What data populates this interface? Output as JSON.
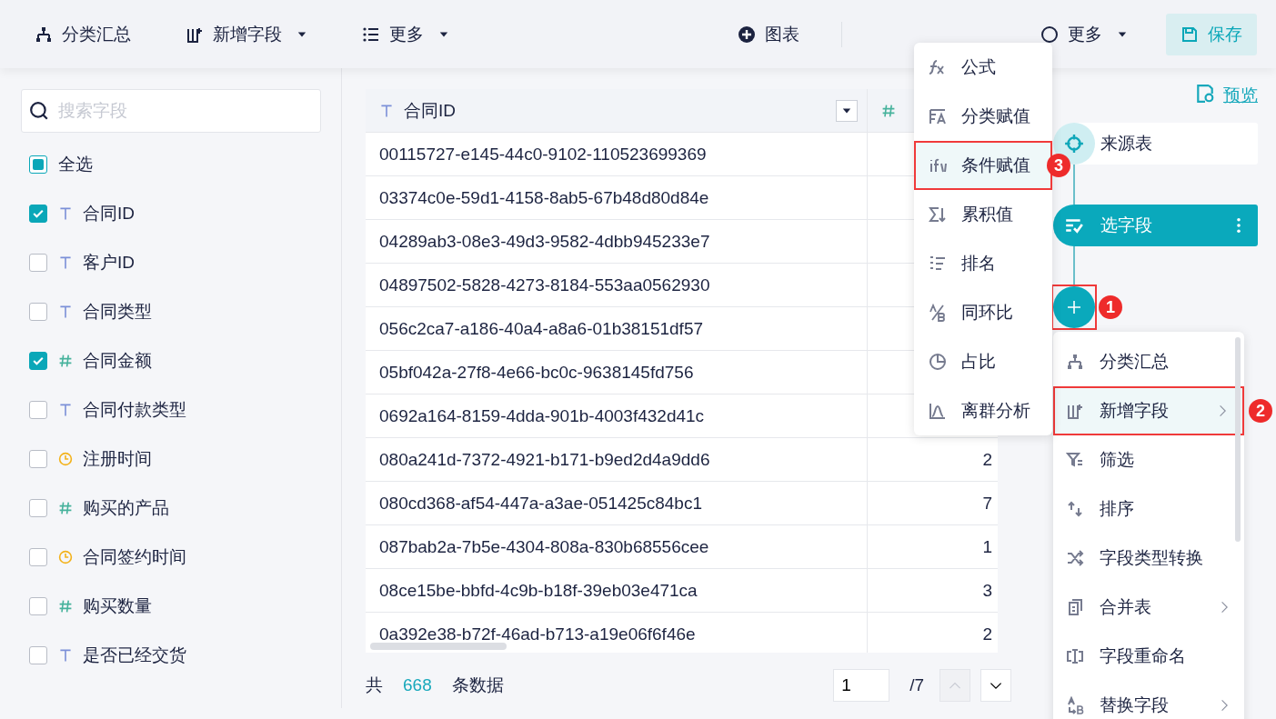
{
  "toolbar": {
    "left": [
      {
        "kind": "summary",
        "label": "分类汇总",
        "dropdown": false
      },
      {
        "kind": "add_field",
        "label": "新增字段",
        "dropdown": true
      },
      {
        "kind": "list",
        "label": "更多",
        "dropdown": true
      }
    ],
    "right": [
      {
        "kind": "chart",
        "label": "图表",
        "dropdown": false
      },
      {
        "kind": "more",
        "label": "更多",
        "dropdown": true
      }
    ],
    "save": "保存"
  },
  "field_panel": {
    "search": {
      "placeholder": "搜索字段"
    },
    "select_all": {
      "label": "全选",
      "checked": false,
      "indeterminate": true
    },
    "fields": [
      {
        "kind": "text",
        "name": "合同ID",
        "checked": true
      },
      {
        "kind": "text",
        "name": "客户ID",
        "checked": false
      },
      {
        "kind": "text",
        "name": "合同类型",
        "checked": false
      },
      {
        "kind": "number",
        "name": "合同金额",
        "checked": true
      },
      {
        "kind": "text",
        "name": "合同付款类型",
        "checked": false
      },
      {
        "kind": "date",
        "name": "注册时间",
        "checked": false
      },
      {
        "kind": "number",
        "name": "购买的产品",
        "checked": false
      },
      {
        "kind": "date",
        "name": "合同签约时间",
        "checked": false
      },
      {
        "kind": "number",
        "name": "购买数量",
        "checked": false
      },
      {
        "kind": "text",
        "name": "是否已经交货",
        "checked": false
      }
    ]
  },
  "table": {
    "columns": [
      {
        "kind": "text",
        "name": "合同ID"
      },
      {
        "kind": "number"
      }
    ],
    "rows": [
      [
        "00115727-e145-44c0-9102-110523699369"
      ],
      [
        "03374c0e-59d1-4158-8ab5-67b48d80d84e"
      ],
      [
        "04289ab3-08e3-49d3-9582-4dbb945233e7"
      ],
      [
        "04897502-5828-4273-8184-553aa0562930"
      ],
      [
        "056c2ca7-a186-40a4-a8a6-01b38151df57"
      ],
      [
        "05bf042a-27f8-4e66-bc0c-9638145fd756"
      ],
      [
        "0692a164-8159-4dda-901b-4003f432d41c"
      ],
      [
        "080a241d-7372-4921-b171-b9ed2d4a9dd6",
        "2"
      ],
      [
        "080cd368-af54-447a-a3ae-051425c84bc1",
        "7"
      ],
      [
        "087bab2a-7b5e-4304-808a-830b68556cee",
        "1"
      ],
      [
        "08ce15be-bbfd-4c9b-b18f-39eb03e471ca",
        "3"
      ],
      [
        "0a392e38-b72f-46ad-b713-a19e06f6f46e",
        "2"
      ]
    ]
  },
  "footer": {
    "prefix": "共",
    "count": "668",
    "suffix": "条数据",
    "page": "1",
    "pages": "/7",
    "prev_button": {
      "disabled": true
    },
    "next_button": {
      "disabled": false
    }
  },
  "preview": "预览",
  "flow": {
    "nodes": [
      {
        "kind": "source",
        "label": "来源表",
        "active": false
      },
      {
        "kind": "select",
        "label": "选字段",
        "active": true
      }
    ],
    "add_callout": "1"
  },
  "operations_menu": {
    "items": [
      {
        "kind": "summary",
        "label": "分类汇总",
        "submenu": false,
        "selected": false
      },
      {
        "kind": "add_field",
        "label": "新增字段",
        "submenu": true,
        "selected": true,
        "callout": "2"
      },
      {
        "kind": "filter",
        "label": "筛选",
        "submenu": false,
        "selected": false
      },
      {
        "kind": "sort",
        "label": "排序",
        "submenu": false,
        "selected": false
      },
      {
        "kind": "convert",
        "label": "字段类型转换",
        "submenu": false,
        "selected": false
      },
      {
        "kind": "merge",
        "label": "合并表",
        "submenu": true,
        "selected": false
      },
      {
        "kind": "rename",
        "label": "字段重命名",
        "submenu": false,
        "selected": false
      },
      {
        "kind": "replace",
        "label": "替换字段",
        "submenu": true,
        "selected": false
      }
    ]
  },
  "add_field_menu": {
    "items": [
      {
        "kind": "formula",
        "label": "公式",
        "selected": false
      },
      {
        "kind": "group_assign",
        "label": "分类赋值",
        "selected": false
      },
      {
        "kind": "if",
        "label": "条件赋值",
        "selected": true,
        "callout": "3"
      },
      {
        "kind": "cumulative",
        "label": "累积值",
        "selected": false
      },
      {
        "kind": "rank",
        "label": "排名",
        "selected": false
      },
      {
        "kind": "ratio",
        "label": "同环比",
        "selected": false
      },
      {
        "kind": "pie",
        "label": "占比",
        "selected": false
      },
      {
        "kind": "outlier",
        "label": "离群分析",
        "selected": false
      }
    ]
  }
}
